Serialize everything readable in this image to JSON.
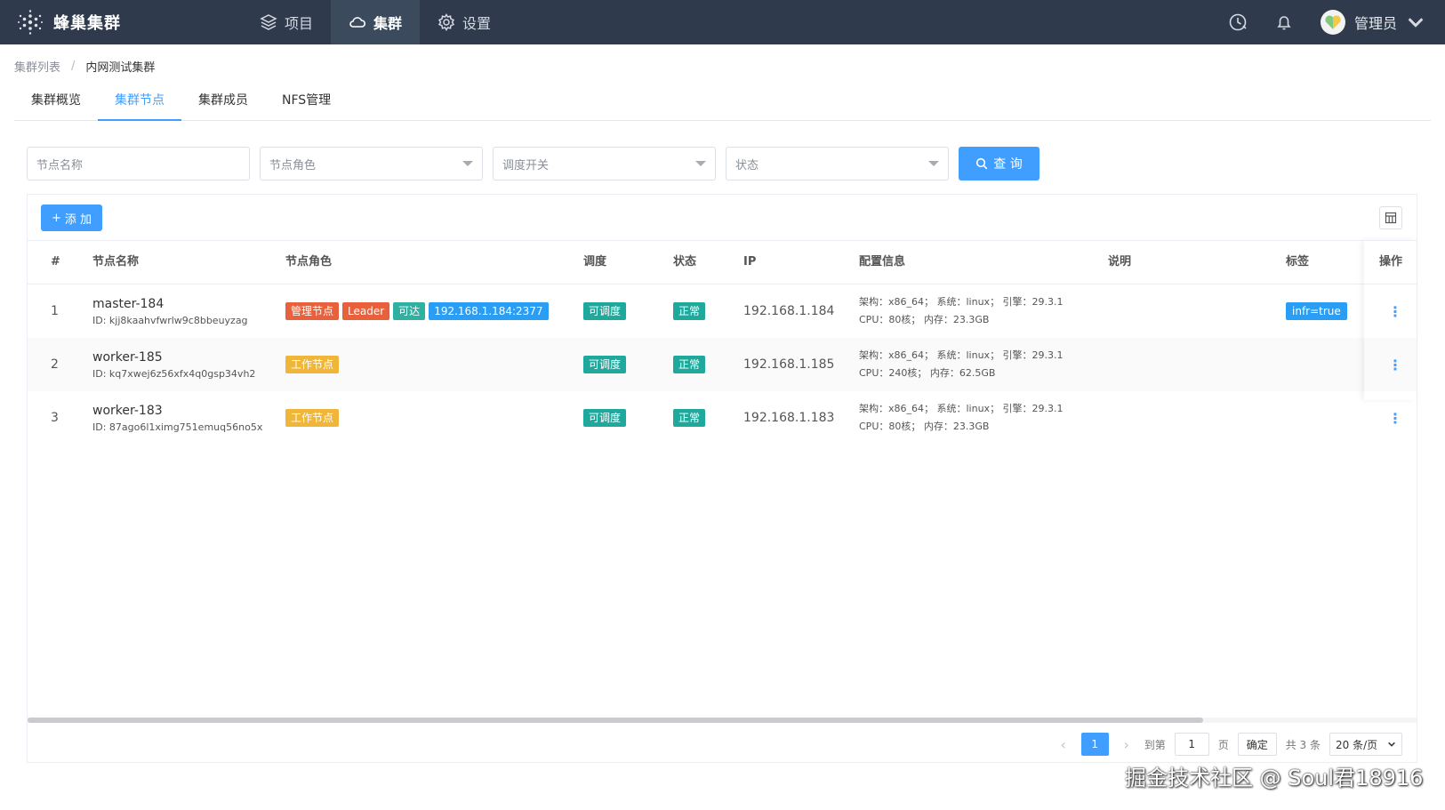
{
  "app": {
    "name": "蜂巢集群"
  },
  "nav": [
    {
      "label": "项目",
      "icon": "layers-icon"
    },
    {
      "label": "集群",
      "icon": "cloud-icon"
    },
    {
      "label": "设置",
      "icon": "gear-icon"
    }
  ],
  "user": {
    "name": "管理员"
  },
  "breadcrumb": {
    "parent": "集群列表",
    "separator": "/",
    "current": "内网测试集群"
  },
  "tabs": [
    "集群概览",
    "集群节点",
    "集群成员",
    "NFS管理"
  ],
  "filters": {
    "name_placeholder": "节点名称",
    "role_placeholder": "节点角色",
    "schedule_placeholder": "调度开关",
    "status_placeholder": "状态",
    "query_label": "查 询"
  },
  "toolbar": {
    "add_label": "添 加"
  },
  "table": {
    "headers": [
      "#",
      "节点名称",
      "节点角色",
      "调度",
      "状态",
      "IP",
      "配置信息",
      "说明",
      "标签",
      "操作"
    ],
    "rows": [
      {
        "index": "1",
        "name": "master-184",
        "id": "ID: kjj8kaahvfwrlw9c8bbeuyzag",
        "roles": [
          "管理节点",
          "Leader",
          "可达",
          "192.168.1.184:2377"
        ],
        "schedule": "可调度",
        "status": "正常",
        "ip": "192.168.1.184",
        "cfg1": "架构：x86_64；  系统：linux；  引擎：29.3.1",
        "cfg2": "CPU：80核；  内存：23.3GB",
        "label": "infr=true"
      },
      {
        "index": "2",
        "name": "worker-185",
        "id": "ID: kq7xwej6z56xfx4q0gsp34vh2",
        "roles": [
          "工作节点"
        ],
        "schedule": "可调度",
        "status": "正常",
        "ip": "192.168.1.185",
        "cfg1": "架构：x86_64；  系统：linux；  引擎：29.3.1",
        "cfg2": "CPU：240核；  内存：62.5GB",
        "label": ""
      },
      {
        "index": "3",
        "name": "worker-183",
        "id": "ID: 87ago6l1ximg751emuq56no5x",
        "roles": [
          "工作节点"
        ],
        "schedule": "可调度",
        "status": "正常",
        "ip": "192.168.1.183",
        "cfg1": "架构：x86_64；  系统：linux；  引擎：29.3.1",
        "cfg2": "CPU：80核；  内存：23.3GB",
        "label": ""
      }
    ]
  },
  "pagination": {
    "current": "1",
    "goto_label": "到第",
    "goto_value": "1",
    "page_label": "页",
    "confirm_label": "确定",
    "total": "共 3 条",
    "page_size": "20 条/页"
  },
  "watermark": "掘金技术社区 @ Soul君18916",
  "colors": {
    "topbar": "#2f3b4c",
    "primary": "#409eff"
  }
}
